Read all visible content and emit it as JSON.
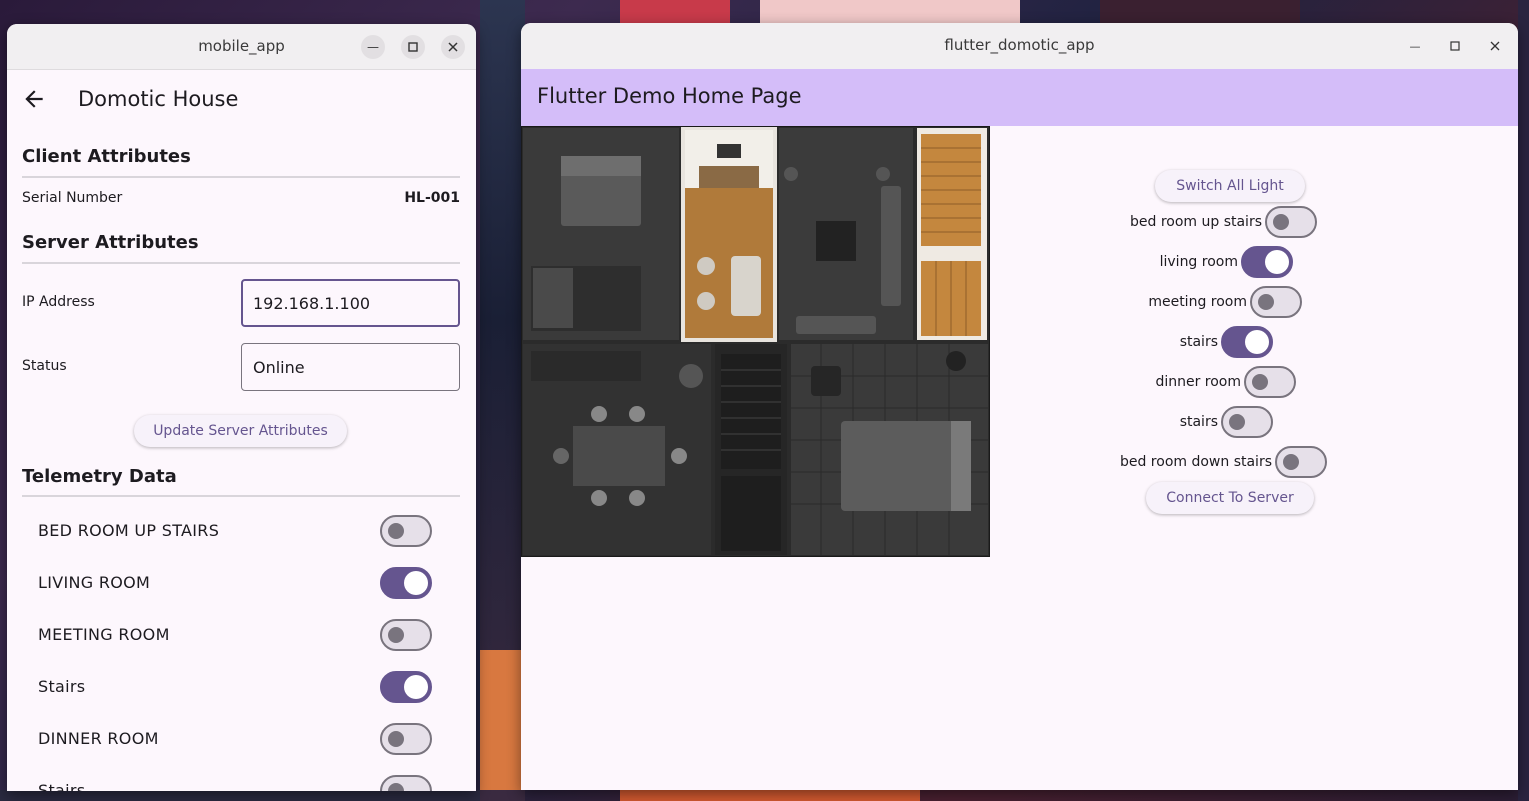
{
  "left_window": {
    "title": "mobile_app",
    "appbar": {
      "title": "Domotic House"
    },
    "client_attributes": {
      "heading": "Client Attributes",
      "serial_label": "Serial Number",
      "serial_value": "HL-001"
    },
    "server_attributes": {
      "heading": "Server Attributes",
      "ip_label": "IP Address",
      "ip_value": "192.168.1.100",
      "status_label": "Status",
      "status_value": "Online",
      "update_button": "Update Server Attributes"
    },
    "telemetry": {
      "heading": "Telemetry Data",
      "items": [
        {
          "label": "BED ROOM UP STAIRS",
          "on": false
        },
        {
          "label": "LIVING ROOM",
          "on": true
        },
        {
          "label": "MEETING ROOM",
          "on": false
        },
        {
          "label": "Stairs",
          "on": true
        },
        {
          "label": "DINNER ROOM",
          "on": false
        },
        {
          "label": "Stairs",
          "on": false
        }
      ]
    }
  },
  "right_window": {
    "title": "flutter_domotic_app",
    "appbar": {
      "title": "Flutter Demo Home Page"
    },
    "switch_all_button": "Switch All Light",
    "connect_button": "Connect To Server",
    "rooms": [
      {
        "label": "bed room up stairs",
        "on": false
      },
      {
        "label": "living room",
        "on": true
      },
      {
        "label": "meeting room",
        "on": false
      },
      {
        "label": "stairs",
        "on": true
      },
      {
        "label": "dinner room",
        "on": false
      },
      {
        "label": "stairs",
        "on": false
      },
      {
        "label": "bed room down stairs",
        "on": false
      }
    ]
  },
  "colors": {
    "accent": "#65558f",
    "appbar": "#d4bdf9",
    "surface": "#fdf7fd"
  },
  "icons": {
    "back": "arrow-left-icon",
    "minimize": "minimize-icon",
    "maximize": "maximize-icon",
    "close": "close-icon"
  }
}
